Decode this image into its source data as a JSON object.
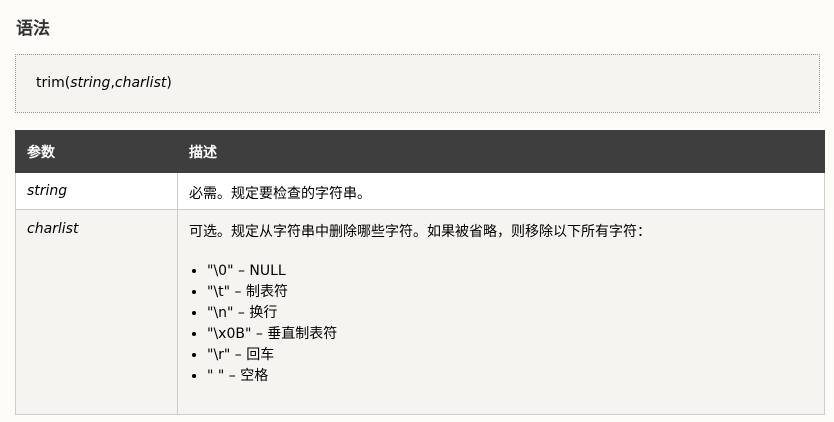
{
  "syntax": {
    "heading": "语法",
    "code": {
      "func": "trim(",
      "arg1": "string",
      "sep": ",",
      "arg2": "charlist",
      "close": ")"
    }
  },
  "table": {
    "headers": [
      "参数",
      "描述"
    ],
    "rows": [
      {
        "param": "string",
        "desc": "必需。规定要检查的字符串。"
      },
      {
        "param": "charlist",
        "desc": "可选。规定从字符串中删除哪些字符。如果被省略，则移除以下所有字符：",
        "items": [
          "\"\\0\" – NULL",
          "\"\\t\" – 制表符",
          "\"\\n\" – 换行",
          "\"\\x0B\" – 垂直制表符",
          "\"\\r\" – 回车",
          "\" \" – 空格"
        ]
      }
    ]
  }
}
